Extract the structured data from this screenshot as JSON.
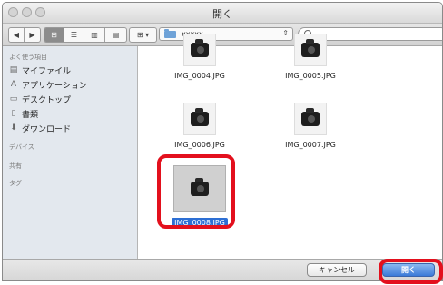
{
  "window": {
    "title": "開く"
  },
  "toolbar": {
    "back": "◀",
    "forward": "▶",
    "view_icon": "⊞",
    "view_list": "☰",
    "view_column": "▥",
    "view_coverflow": "▤",
    "arrange": "⊞ ▾",
    "location": "xxxxx",
    "location_arrow": "⇕",
    "search_value": ""
  },
  "sidebar": {
    "favorites_header": "よく使う項目",
    "items": [
      {
        "label": "マイファイル",
        "icon": "my-files-icon"
      },
      {
        "label": "アプリケーション",
        "icon": "applications-icon"
      },
      {
        "label": "デスクトップ",
        "icon": "desktop-icon"
      },
      {
        "label": "書類",
        "icon": "documents-icon"
      },
      {
        "label": "ダウンロード",
        "icon": "downloads-icon"
      }
    ],
    "devices_header": "デバイス",
    "shared_header": "共有",
    "tags_header": "タグ"
  },
  "files": [
    {
      "name": "IMG_0004.JPG"
    },
    {
      "name": "IMG_0005.JPG"
    },
    {
      "name": "IMG_0006.JPG"
    },
    {
      "name": "IMG_0007.JPG"
    },
    {
      "name": "IMG_0008.JPG",
      "selected": true
    }
  ],
  "buttons": {
    "cancel": "キャンセル",
    "open": "開く"
  },
  "colors": {
    "highlight": "#e3101d",
    "selection": "#2d6fd4",
    "primary": "#3a7ad8"
  }
}
